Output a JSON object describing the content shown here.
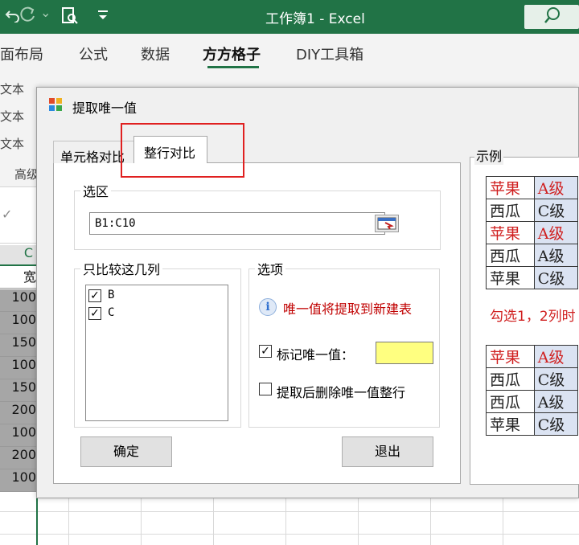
{
  "titlebar": {
    "title": "工作簿1  -  Excel",
    "undo_icon": "undo-icon",
    "redo_icon": "redo-icon",
    "chevron": "⌄",
    "search_icon": "search-icon"
  },
  "ribbon_tabs": [
    {
      "label": "面布局"
    },
    {
      "label": "公式"
    },
    {
      "label": "数据"
    },
    {
      "label": "方方格子"
    },
    {
      "label": "DIY工具箱"
    }
  ],
  "ribbon_small": [
    "文本",
    "文本",
    "文本",
    "高级"
  ],
  "column_header": "C",
  "cells": [
    "宽",
    "100",
    "100",
    "150",
    "100",
    "150",
    "200",
    "100",
    "200",
    "100"
  ],
  "dialog": {
    "title": "提取唯一值",
    "tabs": [
      "单元格对比",
      "整行对比"
    ],
    "active_tab": "整行对比",
    "range_group": "选区",
    "range_value": "B1:C10",
    "columns_group": "只比较这几列",
    "columns": [
      {
        "label": "B",
        "checked": true
      },
      {
        "label": "C",
        "checked": true
      }
    ],
    "options_group": "选项",
    "info_text": "唯一值将提取到新建表",
    "mark_label": "标记唯一值：",
    "mark_checked": "☑",
    "mark_color": "#FFFF80",
    "delete_label": "提取后删除唯一值整行",
    "delete_checked": "☐",
    "ok_button": "确定",
    "exit_button": "退出",
    "sample_group": "示例",
    "sample_top": [
      {
        "fruit": "苹果",
        "grade": "A级",
        "highlight": true
      },
      {
        "fruit": "西瓜",
        "grade": "C级",
        "highlight": false
      },
      {
        "fruit": "苹果",
        "grade": "A级",
        "highlight": true
      },
      {
        "fruit": "西瓜",
        "grade": "A级",
        "highlight": false
      },
      {
        "fruit": "苹果",
        "grade": "C级",
        "highlight": false
      }
    ],
    "sample_note": "勾选1，2列时",
    "sample_bottom": [
      {
        "fruit": "苹果",
        "grade": "A级",
        "highlight": true
      },
      {
        "fruit": "西瓜",
        "grade": "C级",
        "highlight": false
      },
      {
        "fruit": "西瓜",
        "grade": "A级",
        "highlight": false
      },
      {
        "fruit": "苹果",
        "grade": "C级",
        "highlight": false
      }
    ]
  }
}
